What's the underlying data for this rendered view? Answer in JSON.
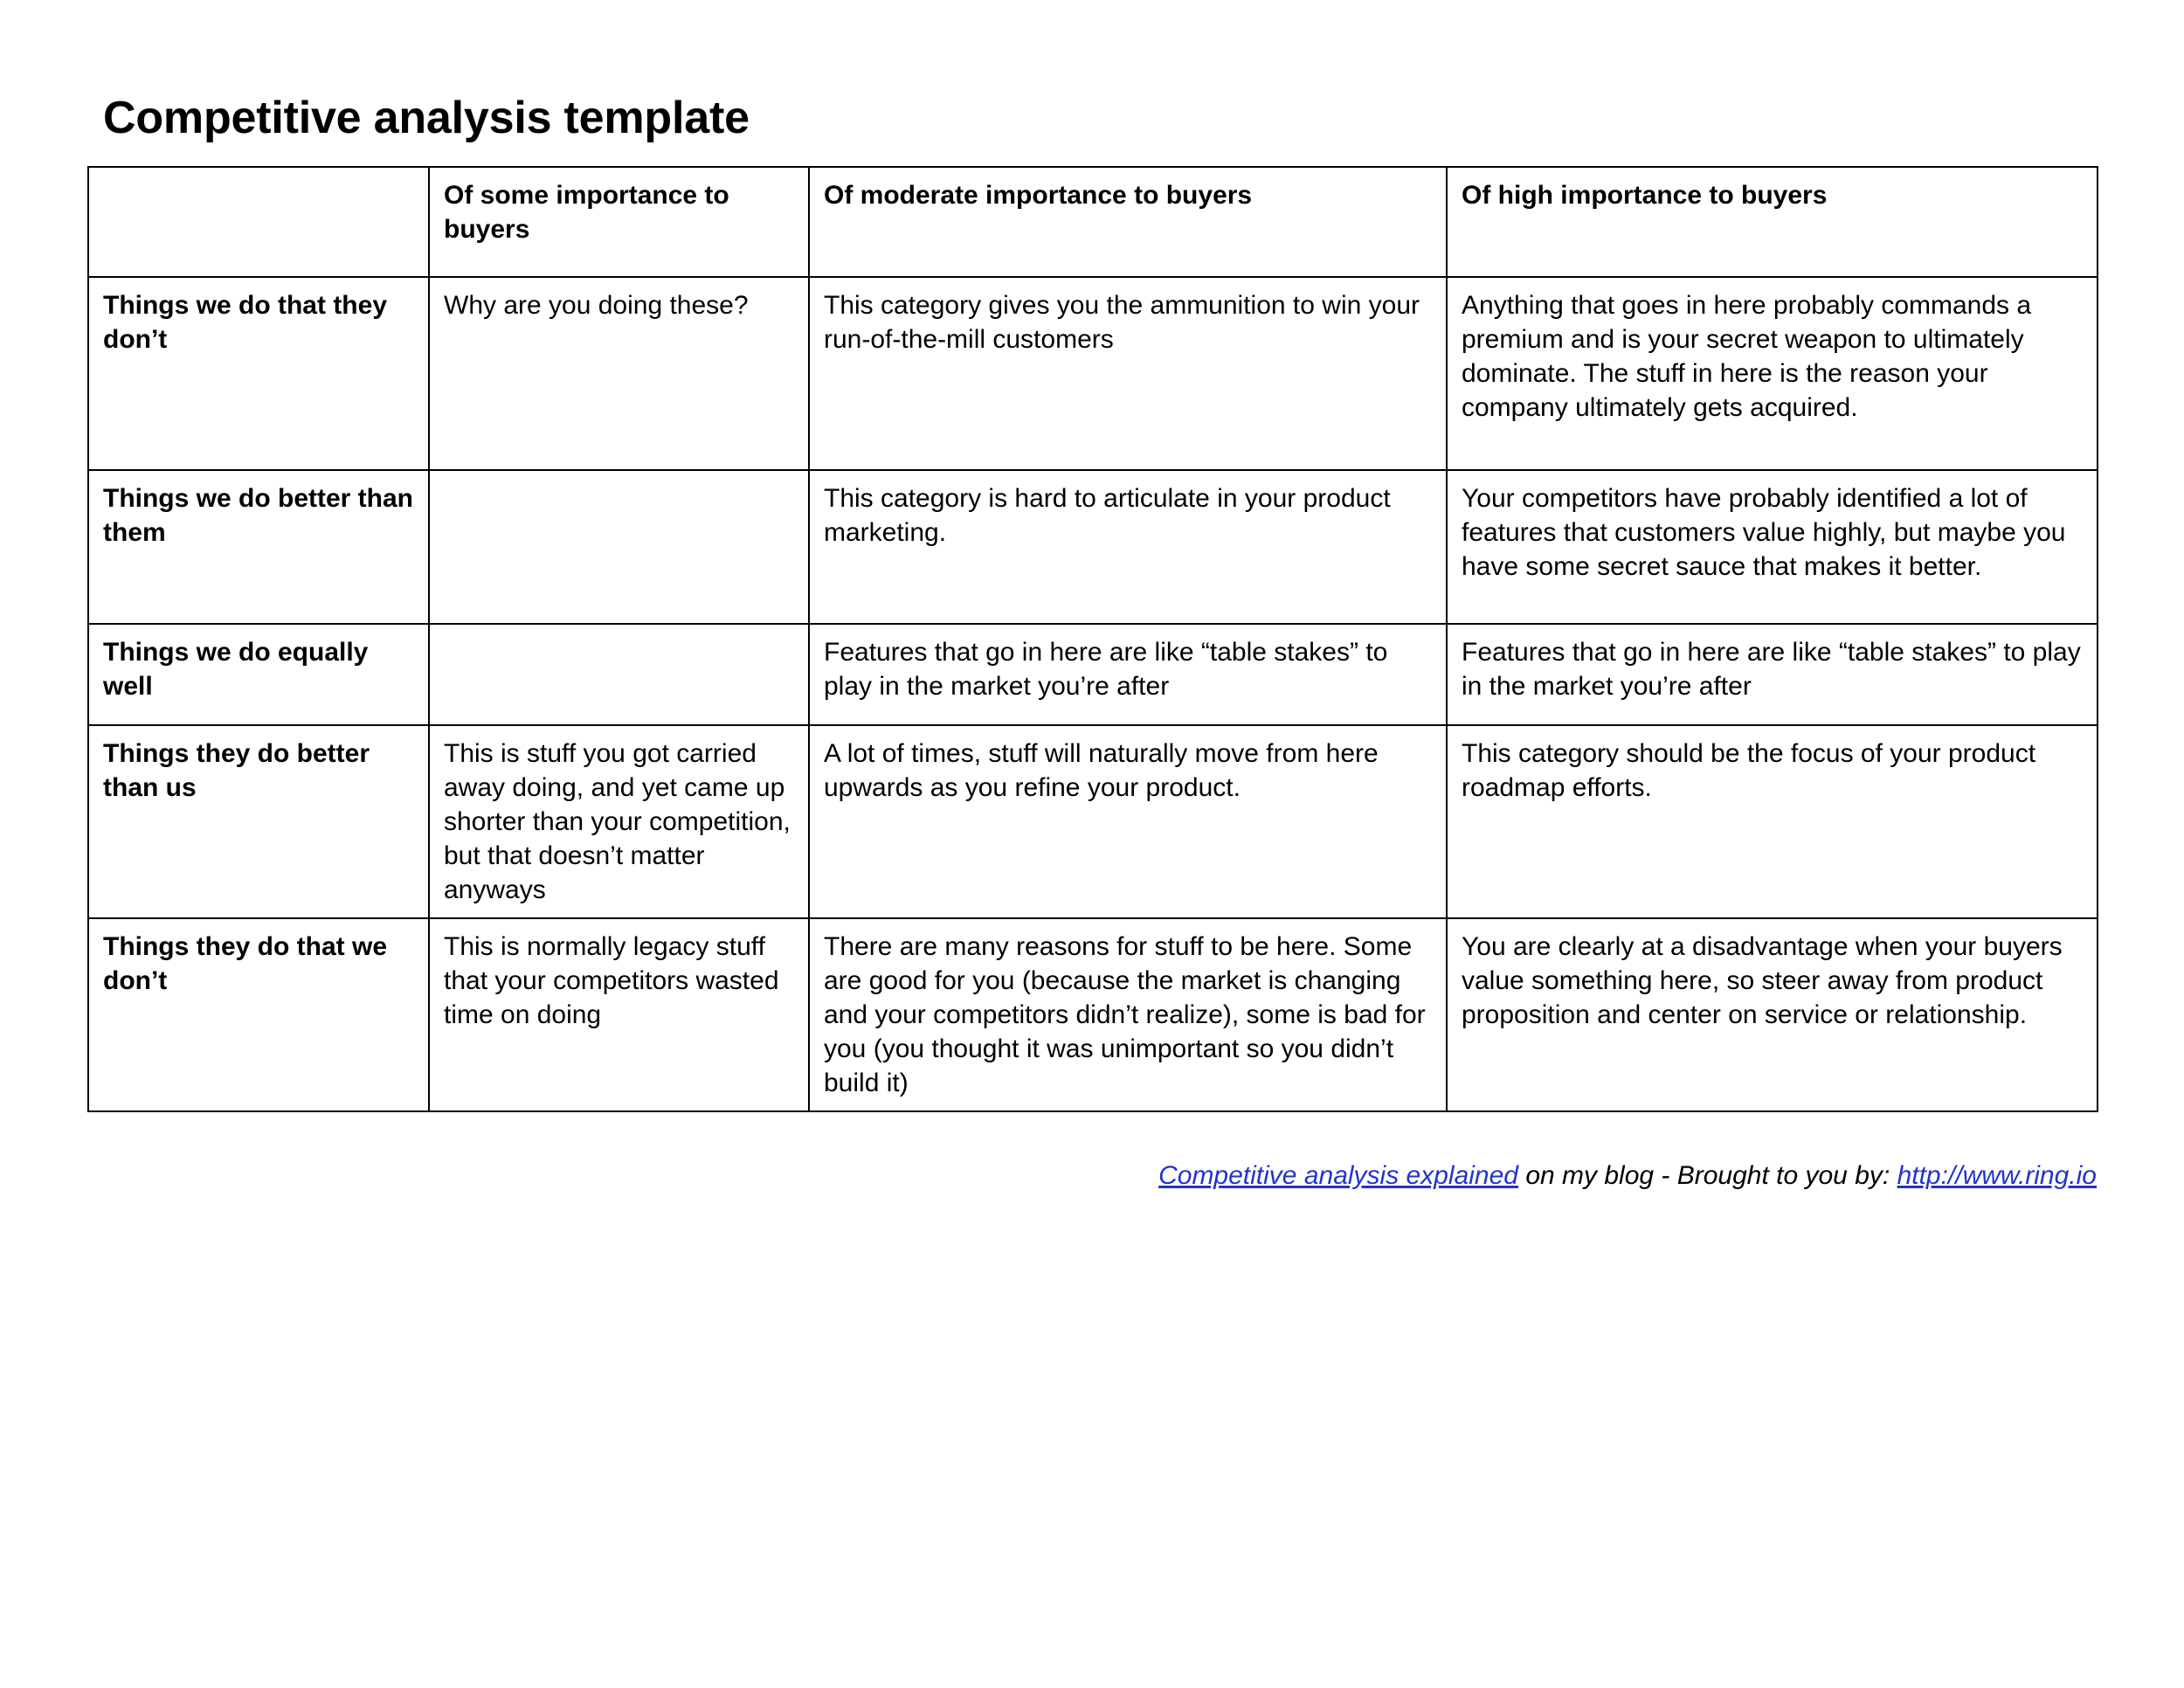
{
  "document": {
    "title": "Competitive analysis template"
  },
  "colors": {
    "yellow": "#ffe490",
    "green": "#b3d9a3",
    "pink": "#f4cbce",
    "purple": "#b3a8db",
    "link": "#2233cc",
    "border": "#000000",
    "background": "#ffffff"
  },
  "matrix": {
    "corner_header": "",
    "column_headers": [
      "Of some importance to buyers",
      "Of moderate importance to buyers",
      "Of high importance to buyers"
    ],
    "rows": [
      {
        "label": "Things we do that they don’t",
        "cells": [
          {
            "text": "Why are you doing these?",
            "fill": "none"
          },
          {
            "text": "This category gives you the ammunition to win your run-of-the-mill customers",
            "fill": "yellow"
          },
          {
            "text": "Anything that goes in here probably commands a premium and is your secret weapon to ultimately dominate. The stuff in here is the reason your company ultimately gets acquired.",
            "fill": "green"
          }
        ]
      },
      {
        "label": "Things we do better than them",
        "cells": [
          {
            "text": "",
            "fill": "none"
          },
          {
            "text": "This category is hard to articulate in your product marketing.",
            "fill": "yellow"
          },
          {
            "text": "Your competitors have probably identified a lot of features that customers value highly, but maybe you have some secret sauce that makes it better.",
            "fill": "green"
          }
        ]
      },
      {
        "label": "Things we do equally well",
        "cells": [
          {
            "text": "",
            "fill": "none"
          },
          {
            "text": "Features that go in here are like “table stakes” to play in the market you’re after",
            "fill": "none"
          },
          {
            "text": "Features that go in here are like “table stakes” to play in the market you’re after",
            "fill": "none"
          }
        ]
      },
      {
        "label": "Things they do better than us",
        "cells": [
          {
            "text": "This is stuff you got carried away doing, and yet came up shorter than your competition, but that doesn’t matter anyways",
            "fill": "pink"
          },
          {
            "text": "A lot of times, stuff will naturally move from here upwards as you refine your product.",
            "fill": "pink"
          },
          {
            "text": "This category should be the focus of your product roadmap efforts.",
            "fill": "purple"
          }
        ]
      },
      {
        "label": "Things they do that we don’t",
        "cells": [
          {
            "text": "This is normally legacy stuff that your competitors wasted time on doing",
            "fill": "pink"
          },
          {
            "text": "There are many reasons for stuff to be here. Some are good for you (because the market is changing and your competitors didn’t realize), some is bad for you (you thought it was unimportant so you didn’t build it)",
            "fill": "pink"
          },
          {
            "text": "You are clearly at a disadvantage when your buyers value something here, so steer away from product proposition and center on service or relationship.",
            "fill": "purple"
          }
        ]
      }
    ]
  },
  "footer": {
    "link_text": "Competitive analysis explained",
    "middle_text": " on my blog - Brought to you by: ",
    "url_text": "http://www.ring.io"
  }
}
